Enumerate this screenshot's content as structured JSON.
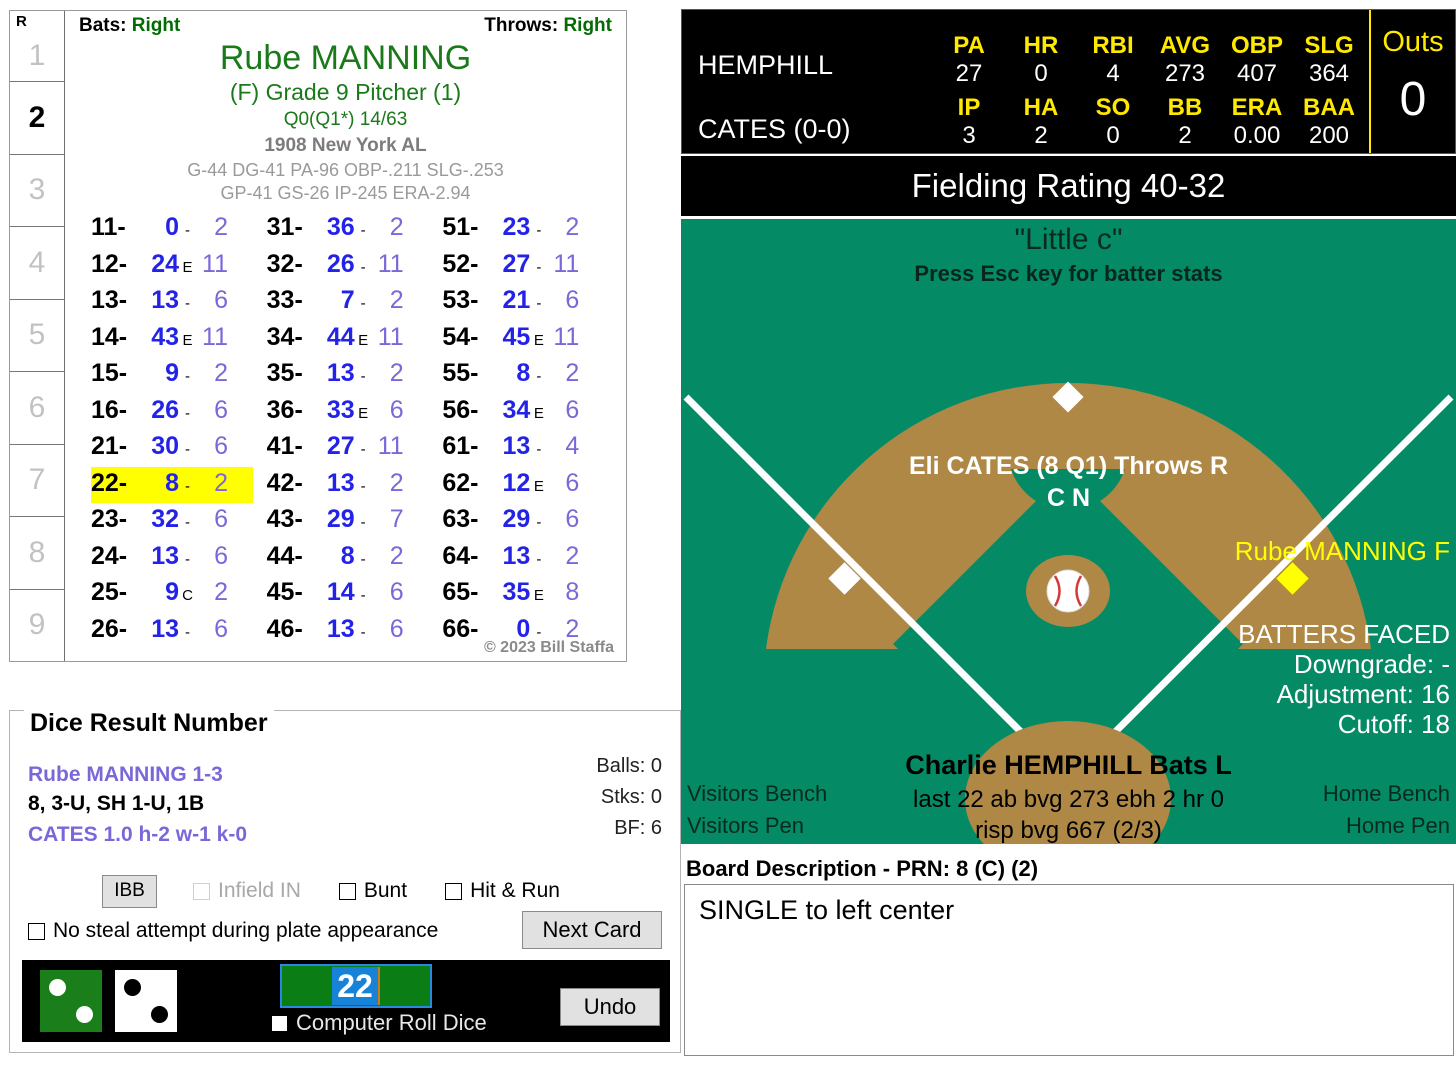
{
  "card": {
    "inning_header": "R",
    "innings": [
      "1",
      "2",
      "3",
      "4",
      "5",
      "6",
      "7",
      "8",
      "9"
    ],
    "active_inning": "2",
    "bats_label": "Bats:",
    "bats_value": "Right",
    "throws_label": "Throws:",
    "throws_value": "Right",
    "player_name": "Rube MANNING",
    "grade_line": "(F) Grade 9 Pitcher (1)",
    "q_line": "Q0(Q1*)   14/63",
    "team_line": "1908 New York AL",
    "stat_line_1": "G-44 DG-41 PA-96 OBP-.211 SLG-.253",
    "stat_line_2": "GP-41 GS-26 IP-245 ERA-2.94",
    "copyright": "© 2023 Bill Staffa",
    "dice_rows": [
      {
        "key": "11-",
        "val": "0",
        "flag": "-",
        "res": "2",
        "hl": false
      },
      {
        "key": "12-",
        "val": "24",
        "flag": "E",
        "res": "11",
        "hl": false
      },
      {
        "key": "13-",
        "val": "13",
        "flag": "-",
        "res": "6",
        "hl": false
      },
      {
        "key": "14-",
        "val": "43",
        "flag": "E",
        "res": "11",
        "hl": false
      },
      {
        "key": "15-",
        "val": "9",
        "flag": "-",
        "res": "2",
        "hl": false
      },
      {
        "key": "16-",
        "val": "26",
        "flag": "-",
        "res": "6",
        "hl": false
      },
      {
        "key": "21-",
        "val": "30",
        "flag": "-",
        "res": "6",
        "hl": false
      },
      {
        "key": "22-",
        "val": "8",
        "flag": "-",
        "res": "2",
        "hl": true
      },
      {
        "key": "23-",
        "val": "32",
        "flag": "-",
        "res": "6",
        "hl": false
      },
      {
        "key": "24-",
        "val": "13",
        "flag": "-",
        "res": "6",
        "hl": false
      },
      {
        "key": "25-",
        "val": "9",
        "flag": "C",
        "res": "2",
        "hl": false
      },
      {
        "key": "26-",
        "val": "13",
        "flag": "-",
        "res": "6",
        "hl": false
      },
      {
        "key": "31-",
        "val": "36",
        "flag": "-",
        "res": "2",
        "hl": false
      },
      {
        "key": "32-",
        "val": "26",
        "flag": "-",
        "res": "11",
        "hl": false
      },
      {
        "key": "33-",
        "val": "7",
        "flag": "-",
        "res": "2",
        "hl": false
      },
      {
        "key": "34-",
        "val": "44",
        "flag": "E",
        "res": "11",
        "hl": false
      },
      {
        "key": "35-",
        "val": "13",
        "flag": "-",
        "res": "2",
        "hl": false
      },
      {
        "key": "36-",
        "val": "33",
        "flag": "E",
        "res": "6",
        "hl": false
      },
      {
        "key": "41-",
        "val": "27",
        "flag": "-",
        "res": "11",
        "hl": false
      },
      {
        "key": "42-",
        "val": "13",
        "flag": "-",
        "res": "2",
        "hl": false
      },
      {
        "key": "43-",
        "val": "29",
        "flag": "-",
        "res": "7",
        "hl": false
      },
      {
        "key": "44-",
        "val": "8",
        "flag": "-",
        "res": "2",
        "hl": false
      },
      {
        "key": "45-",
        "val": "14",
        "flag": "-",
        "res": "6",
        "hl": false
      },
      {
        "key": "46-",
        "val": "13",
        "flag": "-",
        "res": "6",
        "hl": false
      },
      {
        "key": "51-",
        "val": "23",
        "flag": "-",
        "res": "2",
        "hl": false
      },
      {
        "key": "52-",
        "val": "27",
        "flag": "-",
        "res": "11",
        "hl": false
      },
      {
        "key": "53-",
        "val": "21",
        "flag": "-",
        "res": "6",
        "hl": false
      },
      {
        "key": "54-",
        "val": "45",
        "flag": "E",
        "res": "11",
        "hl": false
      },
      {
        "key": "55-",
        "val": "8",
        "flag": "-",
        "res": "2",
        "hl": false
      },
      {
        "key": "56-",
        "val": "34",
        "flag": "E",
        "res": "6",
        "hl": false
      },
      {
        "key": "61-",
        "val": "13",
        "flag": "-",
        "res": "4",
        "hl": false
      },
      {
        "key": "62-",
        "val": "12",
        "flag": "E",
        "res": "6",
        "hl": false
      },
      {
        "key": "63-",
        "val": "29",
        "flag": "-",
        "res": "6",
        "hl": false
      },
      {
        "key": "64-",
        "val": "13",
        "flag": "-",
        "res": "2",
        "hl": false
      },
      {
        "key": "65-",
        "val": "35",
        "flag": "E",
        "res": "8",
        "hl": false
      },
      {
        "key": "66-",
        "val": "0",
        "flag": "-",
        "res": "2",
        "hl": false
      }
    ]
  },
  "dice_panel": {
    "title": "Dice Result Number",
    "result_line_1": "Rube MANNING  1-3",
    "result_line_2": "8, 3-U, SH 1-U, 1B",
    "result_line_3": "CATES  1.0  h-2  w-1  k-0",
    "balls": "Balls: 0",
    "strikes": "Stks: 0",
    "bf": "BF: 6",
    "ibb_label": "IBB",
    "infield_in_label": "Infield IN",
    "bunt_label": "Bunt",
    "hit_run_label": "Hit & Run",
    "no_steal_label": "No steal attempt during plate appearance",
    "next_card_label": "Next Card",
    "roll_value": "22",
    "computer_roll_label": "Computer Roll Dice",
    "undo_label": "Undo",
    "die1_pips": "2",
    "die2_pips": "2"
  },
  "scoreboard": {
    "batter_row": {
      "name": "HEMPHILL",
      "headers": [
        "PA",
        "HR",
        "RBI",
        "AVG",
        "OBP",
        "SLG"
      ],
      "values": [
        "27",
        "0",
        "4",
        "273",
        "407",
        "364"
      ]
    },
    "pitcher_row": {
      "name": "CATES (0-0)",
      "headers": [
        "IP",
        "HA",
        "SO",
        "BB",
        "ERA",
        "BAA"
      ],
      "values": [
        "3",
        "2",
        "0",
        "2",
        "0.00",
        "200"
      ]
    },
    "outs_label": "Outs",
    "outs_value": "0"
  },
  "field": {
    "fielding_rating": "Fielding Rating 40-32",
    "little_c": "\"Little c\"",
    "esc_hint": "Press Esc key for batter stats",
    "pitcher_line": "Eli CATES (8 Q1) Throws R",
    "pitcher_line2": "C N",
    "fielder_first": "Rube MANNING F",
    "batters_faced_title": "BATTERS FACED",
    "downgrade": "Downgrade: -",
    "adjustment": "Adjustment: 16",
    "cutoff": "Cutoff: 18",
    "batter_name": "Charlie HEMPHILL Bats L",
    "batter_line_1": "last 22 ab bvg 273 ebh 2 hr 0",
    "batter_line_2": "risp bvg 667 (2/3)",
    "visitors_bench": "Visitors Bench",
    "visitors_pen": "Visitors Pen",
    "home_bench": "Home Bench",
    "home_pen": "Home Pen"
  },
  "board": {
    "label": "Board Description - PRN: 8 (C) (2)",
    "text": "SINGLE to left center"
  },
  "colors": {
    "grass": "#058a66",
    "dirt": "#ae8844",
    "accent_yellow": "#ffe900",
    "card_green": "#1a7a1a",
    "dice_blue": "#2323e8",
    "result_purple": "#7b68d8",
    "highlight": "#ffff00"
  }
}
